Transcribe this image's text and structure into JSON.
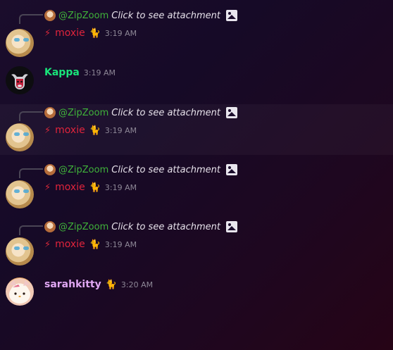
{
  "messages": [
    {
      "reply": {
        "name": "@ZipZoom",
        "text": "Click to see attachment"
      },
      "author": "moxie",
      "bolt": "⚡",
      "cat": "🐈",
      "time": "3:19 AM"
    },
    {
      "author": "Kappa",
      "time": "3:19 AM"
    },
    {
      "reply": {
        "name": "@ZipZoom",
        "text": "Click to see attachment"
      },
      "author": "moxie",
      "bolt": "⚡",
      "cat": "🐈",
      "time": "3:19 AM"
    },
    {
      "reply": {
        "name": "@ZipZoom",
        "text": "Click to see attachment"
      },
      "author": "moxie",
      "bolt": "⚡",
      "cat": "🐈",
      "time": "3:19 AM"
    },
    {
      "reply": {
        "name": "@ZipZoom",
        "text": "Click to see attachment"
      },
      "author": "moxie",
      "bolt": "⚡",
      "cat": "🐈",
      "time": "3:19 AM"
    },
    {
      "author": "sarahkitty",
      "cat": "🐈",
      "time": "3:20 AM"
    }
  ],
  "icons": {
    "reply_avatar": "mini-avatar-icon",
    "attachment": "image-icon",
    "bolt": "lightning-icon",
    "cat": "cat-icon"
  },
  "colors": {
    "reply_name": "#3fb13a",
    "moxie": "#e0243c",
    "kappa": "#19e47a",
    "sarahkitty": "#e0a7f3",
    "timestamp": "#8d8796"
  }
}
